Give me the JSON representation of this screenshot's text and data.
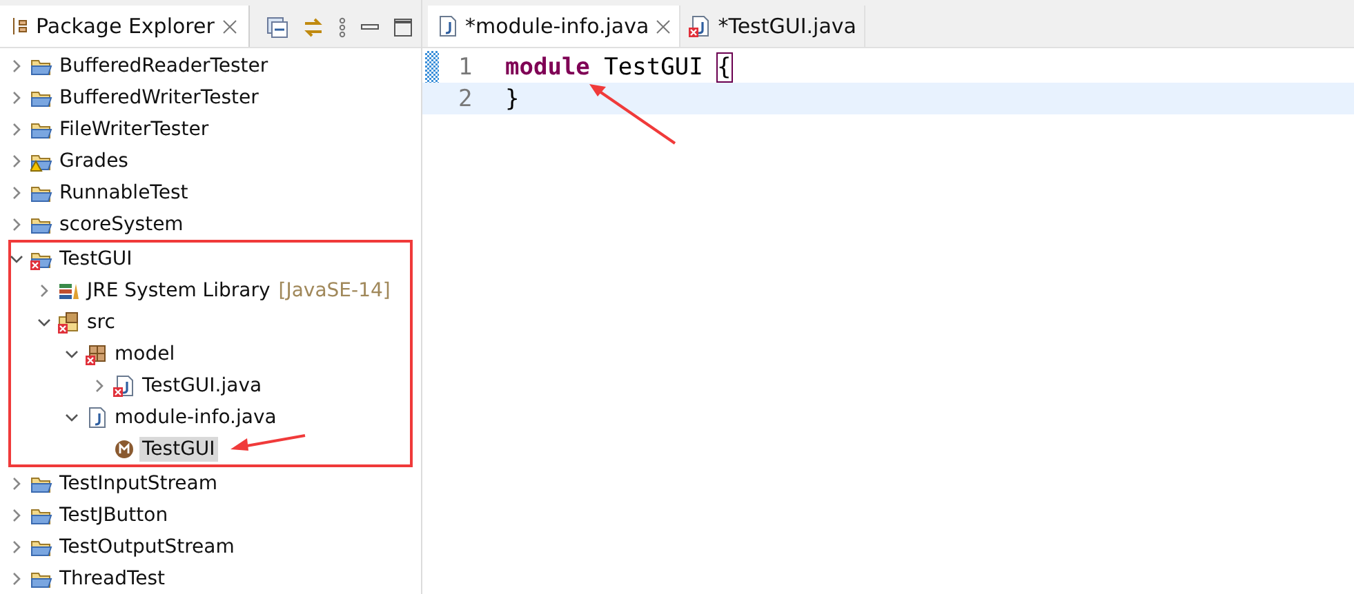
{
  "explorer": {
    "title": "Package Explorer",
    "tree": [
      {
        "label": "BufferedReaderTester",
        "kind": "project",
        "expanded": false,
        "error": false,
        "selected": false
      },
      {
        "label": "BufferedWriterTester",
        "kind": "project",
        "expanded": false,
        "error": false,
        "selected": false
      },
      {
        "label": "FileWriterTester",
        "kind": "project",
        "expanded": false,
        "error": false,
        "selected": false
      },
      {
        "label": "Grades",
        "kind": "project-warning",
        "expanded": false,
        "error": false,
        "selected": false
      },
      {
        "label": "RunnableTest",
        "kind": "project",
        "expanded": false,
        "error": false,
        "selected": false
      },
      {
        "label": "scoreSystem",
        "kind": "project",
        "expanded": false,
        "error": false,
        "selected": false
      },
      {
        "label": "TestGUI",
        "kind": "project",
        "expanded": true,
        "error": true,
        "selected": false,
        "highlighted": true,
        "children": [
          {
            "label": "JRE System Library",
            "suffix": "[JavaSE-14]",
            "kind": "library",
            "expanded": false,
            "error": false,
            "selected": false
          },
          {
            "label": "src",
            "kind": "source-folder",
            "expanded": true,
            "error": true,
            "selected": false,
            "children": [
              {
                "label": "model",
                "kind": "package",
                "expanded": true,
                "error": true,
                "selected": false,
                "children": [
                  {
                    "label": "TestGUI.java",
                    "kind": "java-file",
                    "expanded": false,
                    "error": true,
                    "selected": false
                  }
                ]
              },
              {
                "label": "module-info.java",
                "kind": "java-file",
                "expanded": true,
                "error": false,
                "selected": false,
                "children": [
                  {
                    "label": "TestGUI",
                    "kind": "module",
                    "error": false,
                    "selected": true
                  }
                ]
              }
            ]
          }
        ]
      },
      {
        "label": "TestInputStream",
        "kind": "project",
        "expanded": false,
        "error": false,
        "selected": false
      },
      {
        "label": "TestJButton",
        "kind": "project",
        "expanded": false,
        "error": false,
        "selected": false
      },
      {
        "label": "TestOutputStream",
        "kind": "project",
        "expanded": false,
        "error": false,
        "selected": false
      },
      {
        "label": "ThreadTest",
        "kind": "project",
        "expanded": false,
        "error": false,
        "selected": false
      }
    ]
  },
  "editor": {
    "tabs": [
      {
        "label": "*module-info.java",
        "selected": true,
        "error": false
      },
      {
        "label": "*TestGUI.java",
        "selected": false,
        "error": true
      }
    ],
    "lines": [
      {
        "number": "1",
        "current": false,
        "tokens": [
          {
            "text": "module",
            "kind": "keyword"
          },
          {
            "text": " TestGUI ",
            "kind": "plain"
          },
          {
            "text": "{",
            "kind": "bracket-match"
          }
        ]
      },
      {
        "number": "2",
        "current": true,
        "tokens": [
          {
            "text": "}",
            "kind": "plain"
          }
        ]
      }
    ]
  }
}
